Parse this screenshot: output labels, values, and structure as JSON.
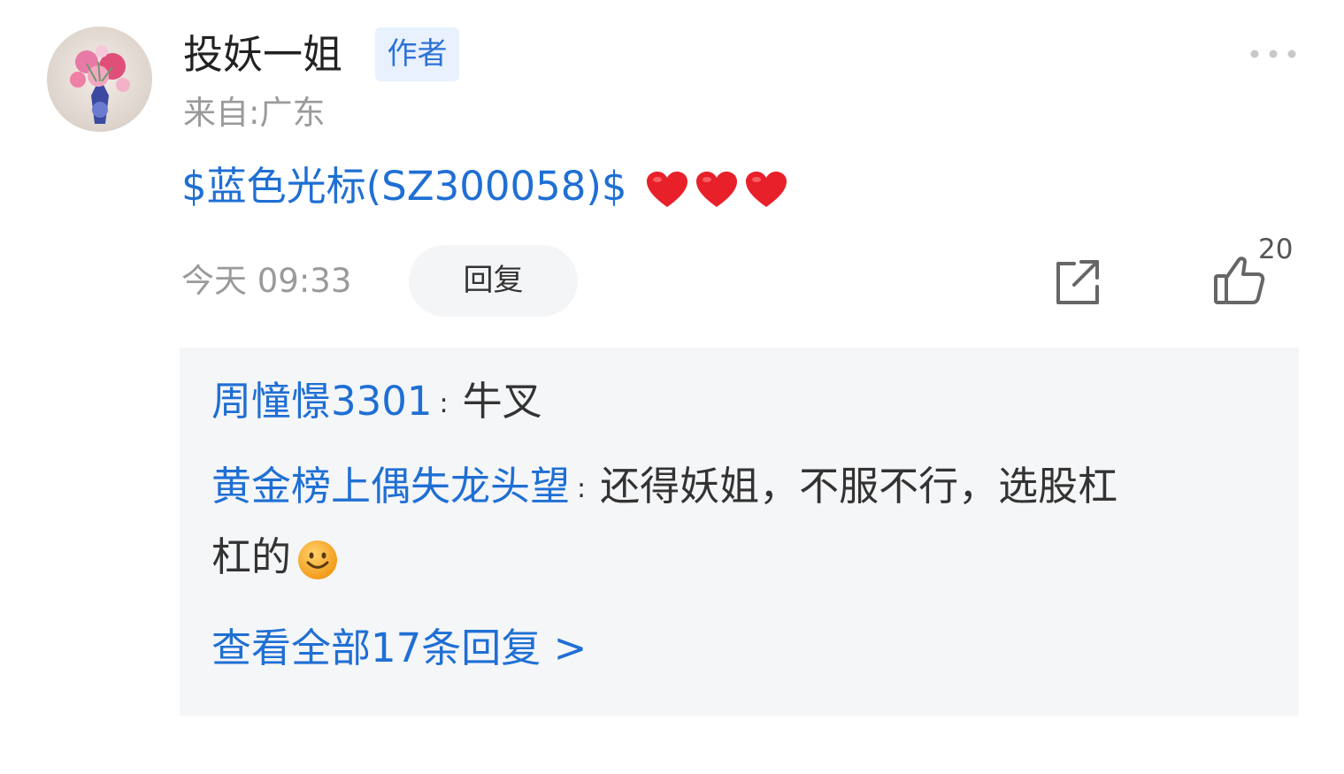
{
  "post": {
    "author_name": "投妖一姐",
    "author_badge": "作者",
    "location": "来自:广东",
    "stock_link": "$蓝色光标(SZ300058)$",
    "emoji": "heart-emoji x3",
    "timestamp": "今天 09:33",
    "reply_label": "回复",
    "like_count": "20"
  },
  "replies": {
    "items": [
      {
        "name": "周憧憬3301",
        "separator": ":",
        "text": "牛叉"
      },
      {
        "name": "黄金榜上偶失龙头望",
        "separator": ":",
        "text": "还得妖姐，不服不行，选股杠",
        "text_cont": "杠的"
      }
    ],
    "view_all": "查看全部17条回复 >"
  },
  "colors": {
    "link_blue": "#1f6fd4",
    "badge_bg": "#e8f1fd",
    "badge_text": "#2f72d6",
    "meta_gray": "#9a9a9a",
    "reply_box_bg": "#f5f6f8",
    "heart_red": "#e8202a"
  },
  "icons": [
    "more-icon",
    "share-icon",
    "like-icon",
    "heart-icon",
    "smile-emoji-icon"
  ]
}
